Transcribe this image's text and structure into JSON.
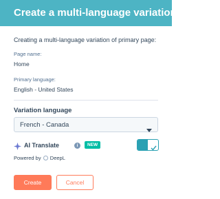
{
  "header": {
    "title": "Create a multi-language variation"
  },
  "intro": "Creating a multi-language variation of primary page:",
  "page_name": {
    "label": "Page name:",
    "value": "Home"
  },
  "primary_language": {
    "label": "Primary language:",
    "value": "English - United States"
  },
  "variation_language": {
    "label": "Variation language",
    "selected": "French - Canada"
  },
  "ai_translate": {
    "label": "AI Translate",
    "badge": "NEW",
    "enabled": true,
    "powered_by": "Powered by",
    "provider": "DeepL"
  },
  "buttons": {
    "create": "Create",
    "cancel": "Cancel"
  },
  "colors": {
    "header": "#4db4c4",
    "accent": "#ff7a59",
    "toggle": "#2aa1b3",
    "badge": "#00bda5"
  }
}
